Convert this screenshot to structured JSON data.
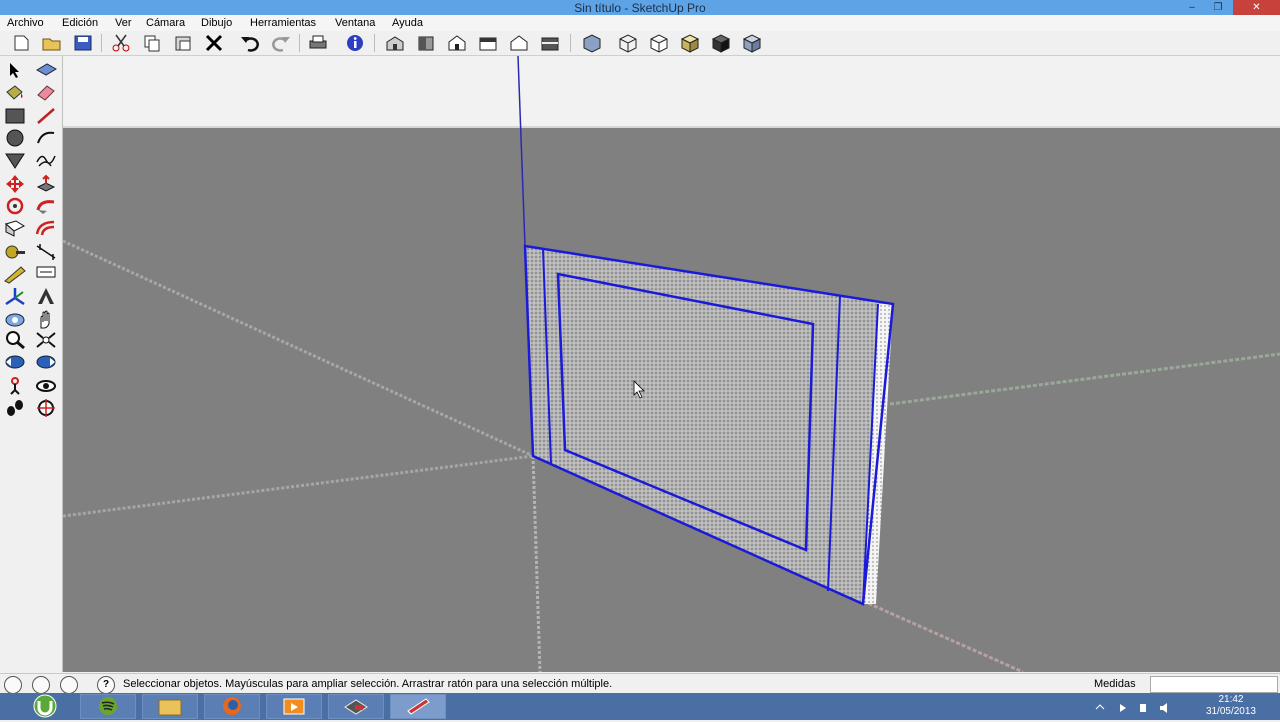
{
  "window": {
    "title": "Sin título - SketchUp Pro",
    "minimize_glyph": "‒",
    "maximize_glyph": "❐",
    "close_glyph": "✕"
  },
  "menu": [
    "Archivo",
    "Edición",
    "Ver",
    "Cámara",
    "Dibujo",
    "Herramientas",
    "Ventana",
    "Ayuda"
  ],
  "toolbar_icons": [
    "new-icon",
    "open-icon",
    "save-icon",
    "cut-icon",
    "copy-icon",
    "paste-icon",
    "erase-icon",
    "undo-icon",
    "redo-icon",
    "print-icon",
    "model-info-icon",
    "iso-view-icon",
    "top-view-icon",
    "front-view-icon",
    "right-view-icon",
    "back-view-icon",
    "left-view-icon",
    "xray-icon",
    "wireframe-icon",
    "hidden-line-icon",
    "shaded-icon",
    "shaded-textures-icon",
    "monochrome-icon"
  ],
  "left_tool_icons": [
    "select-icon",
    "component-icon",
    "paint-bucket-icon",
    "eraser-icon",
    "rectangle-icon",
    "line-icon",
    "circle-icon",
    "arc-icon",
    "polygon-icon",
    "freehand-icon",
    "move-icon",
    "push-pull-icon",
    "rotate-icon",
    "follow-me-icon",
    "scale-icon",
    "offset-icon",
    "tape-measure-icon",
    "dimension-icon",
    "protractor-icon",
    "text-icon",
    "axes-icon",
    "3d-text-icon",
    "orbit-icon",
    "pan-icon",
    "zoom-icon",
    "zoom-extents-icon",
    "previous-view-icon",
    "next-view-icon",
    "position-camera-icon",
    "look-around-icon",
    "walk-icon",
    "section-plane-icon"
  ],
  "status": {
    "help_glyph": "?",
    "message": "Seleccionar objetos. Mayúsculas para ampliar selección. Arrastrar ratón para una selección múltiple.",
    "measure_label": "Medidas",
    "measure_value": ""
  },
  "taskbar": {
    "apps": [
      "utorrent-icon",
      "spotify-icon",
      "file-explorer-icon",
      "firefox-icon",
      "media-player-icon",
      "sketchup-layout-icon",
      "sketchup-icon"
    ],
    "time": "21:42",
    "date": "31/05/2013"
  },
  "colors": {
    "titlebar": "#5ea3e6",
    "viewport_bg": "#808080",
    "sky": "#f2f2f2",
    "selection_blue": "#1a1ad8",
    "taskbar": "#4a6fa5"
  }
}
